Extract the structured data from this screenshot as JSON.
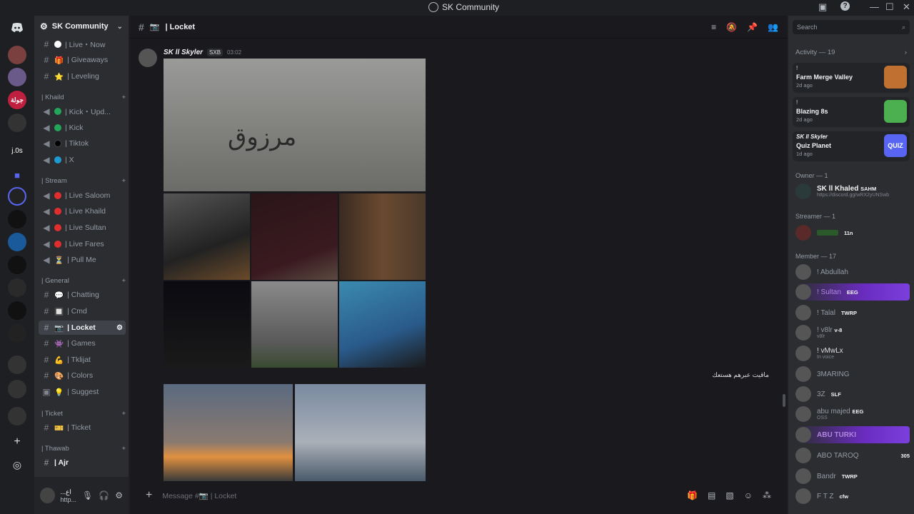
{
  "window": {
    "title": "SK Community",
    "controls": [
      "—",
      "☐",
      "✕"
    ]
  },
  "server": {
    "name": "SK Community"
  },
  "guild_labels": [
    "جولة",
    "j.0s"
  ],
  "channels": {
    "top": [
      {
        "label": "| Live・Now",
        "icon": "#",
        "emoji": "●",
        "color": "#ffffff"
      },
      {
        "label": "| Giveaways",
        "icon": "#",
        "emoji": "🎁",
        "color": "#e04040"
      },
      {
        "label": "| Leveling",
        "icon": "#",
        "emoji": "⭐",
        "color": "#f0c040"
      }
    ],
    "cat_khaild": "| Khaild",
    "khaild": [
      {
        "label": "| Kick・Upd...",
        "color": "#23a55a"
      },
      {
        "label": "| Kick",
        "color": "#23a55a"
      },
      {
        "label": "| Tiktok",
        "color": "#000000"
      },
      {
        "label": "| X",
        "color": "#1d9bd1"
      }
    ],
    "cat_stream": "| Stream",
    "stream": [
      {
        "label": "| Live Saloom",
        "color": "#e02e2e"
      },
      {
        "label": "| Live Khaild",
        "color": "#e02e2e"
      },
      {
        "label": "| Live Sultan",
        "color": "#e02e2e"
      },
      {
        "label": "| Live Fares",
        "color": "#e02e2e"
      },
      {
        "label": "| Pull Me",
        "color": "#cccccc"
      }
    ],
    "cat_general": "| General",
    "general": [
      {
        "label": "| Chatting",
        "emoji": "💬"
      },
      {
        "label": "| Cmd",
        "emoji": "🔲"
      },
      {
        "label": "| Locket",
        "emoji": "📷",
        "active": true
      },
      {
        "label": "| Games",
        "emoji": "👾"
      },
      {
        "label": "| Tklijat",
        "emoji": "💪"
      },
      {
        "label": "| Colors",
        "emoji": "🎨"
      },
      {
        "label": "| Suggest",
        "emoji": "💡"
      }
    ],
    "cat_ticket": "| Ticket",
    "ticket": [
      {
        "label": "| Ticket",
        "emoji": "🎫"
      }
    ],
    "cat_thawab": "| Thawab",
    "thawab": [
      {
        "label": "| Ajr"
      }
    ]
  },
  "user": {
    "name": "...اع",
    "status": "http..."
  },
  "chat": {
    "channel": "| Locket",
    "message": {
      "author": "SK ll Skyler",
      "tag": "SXB",
      "time": "03:02"
    },
    "arabic_line": "ماقيت عبرهم هستعك",
    "photo_caption": "مرزوق",
    "composer_placeholder": "Message #📷 | Locket"
  },
  "members": {
    "search_placeholder": "Search",
    "activity_title": "Activity — 19",
    "activities": [
      {
        "who": "!",
        "game": "Farm Merge Valley",
        "when": "2d ago"
      },
      {
        "who": "!",
        "game": "Blazing 8s",
        "when": "2d ago"
      },
      {
        "who": "SK ll Skyler",
        "game": "Quiz Planet",
        "when": "1d ago"
      }
    ],
    "owner_header": "Owner — 1",
    "owner": {
      "name": "SK ll Khaled",
      "badge": "SAHM",
      "status": "https://discord.gg/wRX2yUNSwb"
    },
    "streamer_header": "Streamer — 1",
    "streamer": {
      "badge": "11n"
    },
    "member_header": "Member — 17",
    "list": [
      {
        "name": "! Abdullah",
        "badge": "",
        "sub": ""
      },
      {
        "name": "! Sultan",
        "badge": "EEG",
        "sub": "",
        "highlight": true
      },
      {
        "name": "! Talal",
        "badge": "TWRP",
        "sub": ""
      },
      {
        "name": "! v8lr",
        "badge": "v-8",
        "sub": "v8lr"
      },
      {
        "name": "! vMwLx",
        "badge": "",
        "sub": "In voice"
      },
      {
        "name": "3MARING",
        "badge": "",
        "sub": ""
      },
      {
        "name": "3Z",
        "badge": "SLF",
        "sub": ""
      },
      {
        "name": "abu majed",
        "badge": "EEG",
        "sub": "OSS"
      },
      {
        "name": "ABU TURKI",
        "badge": "",
        "sub": "",
        "highlight": true
      },
      {
        "name": "ABO TAROQ",
        "badge": "305",
        "sub": ""
      },
      {
        "name": "Bandr",
        "badge": "TWRP",
        "sub": ""
      },
      {
        "name": "F T Z",
        "badge": "cfw",
        "sub": ""
      }
    ]
  }
}
